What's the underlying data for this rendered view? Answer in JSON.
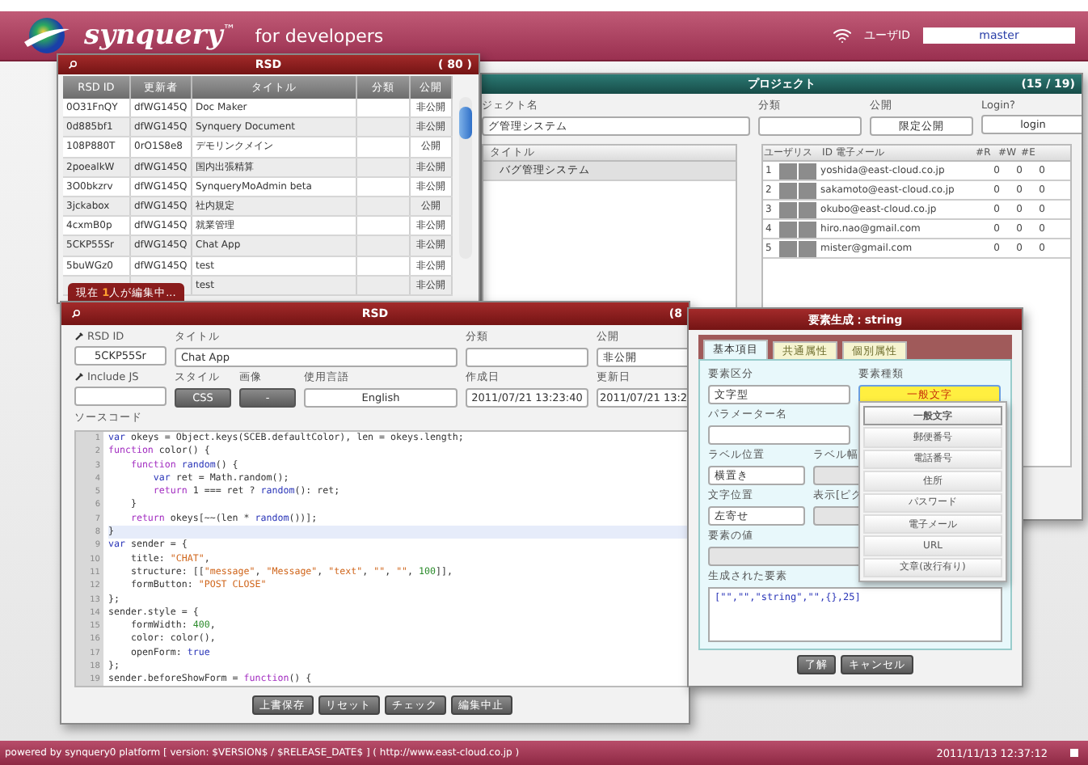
{
  "header": {
    "brand": "synquery",
    "trademark": "™",
    "tagline": "for developers",
    "user_label": "ユーザID",
    "user_value": "master"
  },
  "rsd_list": {
    "title": "RSD",
    "count": "( 80 )",
    "columns": [
      "RSD ID",
      "更新者",
      "タイトル",
      "分類",
      "公開"
    ],
    "rows": [
      {
        "cells": [
          "0O31FnQY",
          "dfWG145Q",
          "Doc Maker",
          "",
          "非公開"
        ]
      },
      {
        "cells": [
          "0d885bf1",
          "dfWG145Q",
          "Synquery Document",
          "",
          "非公開"
        ]
      },
      {
        "cells": [
          "108P880T",
          "0rO1S8e8",
          "デモリンクメイン",
          "",
          "公開"
        ]
      },
      {
        "cells": [
          "2poealkW",
          "dfWG145Q",
          "国内出張精算",
          "",
          "非公開"
        ]
      },
      {
        "cells": [
          "3O0bkzrv",
          "dfWG145Q",
          "SynqueryMoAdmin beta",
          "",
          "非公開"
        ]
      },
      {
        "cells": [
          "3jckabox",
          "dfWG145Q",
          "社内規定",
          "",
          "公開"
        ]
      },
      {
        "cells": [
          "4cxmB0p",
          "dfWG145Q",
          "就業管理",
          "",
          "非公開"
        ]
      },
      {
        "cells": [
          "5CKP55Sr",
          "dfWG145Q",
          "Chat App",
          "",
          "非公開"
        ]
      },
      {
        "cells": [
          "5buWGz0",
          "dfWG145Q",
          "test",
          "",
          "非公開"
        ]
      },
      {
        "cells": [
          "",
          "",
          "test",
          "",
          "非公開"
        ]
      }
    ],
    "notice": "現在 **1**人が編集中..."
  },
  "project": {
    "title": "プロジェクト",
    "count": "(15 / 19)",
    "fields": [
      {
        "label": "ジェクト名",
        "value": "グ管理システム"
      },
      {
        "label": "分類"
      },
      {
        "label": "公開",
        "value": "限定公開"
      },
      {
        "label": "Login?",
        "value": "login"
      }
    ],
    "titles": {
      "header": "タイトル",
      "items": [
        {
          "label": "バグ管理システム",
          "selected": true
        }
      ]
    },
    "users": {
      "columns": [
        "ユーザリス",
        "ID 電子メール",
        "#R",
        "#W",
        "#E"
      ],
      "rows": [
        {
          "no": "1",
          "email": "yoshida@east-cloud.co.jp",
          "r": "0",
          "w": "0",
          "e": "0"
        },
        {
          "no": "2",
          "email": "sakamoto@east-cloud.co.jp",
          "r": "0",
          "w": "0",
          "e": "0"
        },
        {
          "no": "3",
          "email": "okubo@east-cloud.co.jp",
          "r": "0",
          "w": "0",
          "e": "0"
        },
        {
          "no": "4",
          "email": "hiro.nao@gmail.com",
          "r": "0",
          "w": "0",
          "e": "0"
        },
        {
          "no": "5",
          "email": "mister@gmail.com",
          "r": "0",
          "w": "0",
          "e": "0"
        }
      ]
    }
  },
  "rsd_edit": {
    "title": "RSD",
    "count": "(8",
    "field_rows": [
      [
        {
          "label": "RSD ID",
          "kind": "box",
          "value": "5CKP55Sr"
        },
        {
          "label": "タイトル",
          "kind": "input",
          "value": "Chat App"
        },
        {
          "label": "分類",
          "kind": "input"
        },
        {
          "label": "公開",
          "kind": "input",
          "value": "非公開"
        }
      ],
      [
        {
          "label": "Include JS",
          "kind": "input"
        },
        {
          "label": "スタイル",
          "kind": "dark",
          "value": "CSS"
        },
        {
          "label": "画像",
          "kind": "dark",
          "value": "-"
        },
        {
          "label": "使用言語",
          "kind": "box",
          "value": "English"
        },
        {
          "label": "作成日",
          "kind": "box",
          "value": "2011/07/21 13:23:40"
        },
        {
          "label": "更新日",
          "kind": "box",
          "value": "2011/07/21 13:2"
        }
      ]
    ],
    "code_label": "ソースコード",
    "code": [
      {
        "no": "1",
        "highlight": false,
        "tokens": [
          {
            "kind": "keyword",
            "text": "var"
          },
          {
            "kind": "plain",
            "text": " okeys = Object.keys(SCEB.defaultColor), len = okeys.length;"
          }
        ]
      },
      {
        "no": "2",
        "highlight": false,
        "tokens": [
          {
            "kind": "function",
            "text": "function"
          },
          {
            "kind": "plain",
            "text": " color() {"
          }
        ]
      },
      {
        "no": "3",
        "highlight": false,
        "tokens": [
          {
            "kind": "function",
            "text": "    function"
          },
          {
            "kind": "keyword",
            "text": " random"
          },
          {
            "kind": "plain",
            "text": "() {"
          }
        ]
      },
      {
        "no": "4",
        "highlight": false,
        "tokens": [
          {
            "kind": "keyword",
            "text": "        var"
          },
          {
            "kind": "plain",
            "text": " ret = Math.random();"
          }
        ]
      },
      {
        "no": "5",
        "highlight": false,
        "tokens": [
          {
            "kind": "function",
            "text": "        return"
          },
          {
            "kind": "plain",
            "text": " 1 === ret ? "
          },
          {
            "kind": "keyword",
            "text": "random"
          },
          {
            "kind": "plain",
            "text": "(): ret;"
          }
        ]
      },
      {
        "no": "6",
        "highlight": false,
        "tokens": [
          {
            "kind": "plain",
            "text": "    }"
          }
        ]
      },
      {
        "no": "7",
        "highlight": false,
        "tokens": [
          {
            "kind": "function",
            "text": "    return"
          },
          {
            "kind": "plain",
            "text": " okeys[~~(len * "
          },
          {
            "kind": "keyword",
            "text": "random"
          },
          {
            "kind": "plain",
            "text": "())];"
          }
        ]
      },
      {
        "no": "8",
        "highlight": true,
        "tokens": [
          {
            "kind": "plain",
            "text": "}"
          }
        ]
      },
      {
        "no": "9",
        "highlight": false,
        "tokens": [
          {
            "kind": "keyword",
            "text": "var"
          },
          {
            "kind": "plain",
            "text": " sender = {"
          }
        ]
      },
      {
        "no": "10",
        "highlight": false,
        "tokens": [
          {
            "kind": "plain",
            "text": "    title: "
          },
          {
            "kind": "string",
            "text": "\"CHAT\""
          },
          {
            "kind": "plain",
            "text": ","
          }
        ]
      },
      {
        "no": "11",
        "highlight": false,
        "tokens": [
          {
            "kind": "plain",
            "text": "    structure: [["
          },
          {
            "kind": "string",
            "text": "\"message\""
          },
          {
            "kind": "plain",
            "text": ", "
          },
          {
            "kind": "string",
            "text": "\"Message\""
          },
          {
            "kind": "plain",
            "text": ", "
          },
          {
            "kind": "string",
            "text": "\"text\""
          },
          {
            "kind": "plain",
            "text": ", "
          },
          {
            "kind": "string",
            "text": "\"\""
          },
          {
            "kind": "plain",
            "text": ", "
          },
          {
            "kind": "string",
            "text": "\"\""
          },
          {
            "kind": "plain",
            "text": ", "
          },
          {
            "kind": "number",
            "text": "100"
          },
          {
            "kind": "plain",
            "text": "]],"
          }
        ]
      },
      {
        "no": "12",
        "highlight": false,
        "tokens": [
          {
            "kind": "plain",
            "text": "    formButton: "
          },
          {
            "kind": "string",
            "text": "\"POST CLOSE\""
          }
        ]
      },
      {
        "no": "13",
        "highlight": false,
        "tokens": [
          {
            "kind": "plain",
            "text": "};"
          }
        ]
      },
      {
        "no": "14",
        "highlight": false,
        "tokens": [
          {
            "kind": "plain",
            "text": "sender.style = {"
          }
        ]
      },
      {
        "no": "15",
        "highlight": false,
        "tokens": [
          {
            "kind": "plain",
            "text": "    formWidth: "
          },
          {
            "kind": "number",
            "text": "400"
          },
          {
            "kind": "plain",
            "text": ","
          }
        ]
      },
      {
        "no": "16",
        "highlight": false,
        "tokens": [
          {
            "kind": "plain",
            "text": "    color: color(),"
          }
        ]
      },
      {
        "no": "17",
        "highlight": false,
        "tokens": [
          {
            "kind": "plain",
            "text": "    openForm: "
          },
          {
            "kind": "keyword",
            "text": "true"
          }
        ]
      },
      {
        "no": "18",
        "highlight": false,
        "tokens": [
          {
            "kind": "plain",
            "text": "};"
          }
        ]
      },
      {
        "no": "19",
        "highlight": false,
        "tokens": [
          {
            "kind": "plain",
            "text": "sender.beforeShowForm = "
          },
          {
            "kind": "function",
            "text": "function"
          },
          {
            "kind": "plain",
            "text": "() {"
          }
        ]
      }
    ],
    "buttons": [
      "上書保存",
      "リセット",
      "チェック",
      "編集中止"
    ]
  },
  "element_dialog": {
    "title": "要素生成：string",
    "tabs": [
      {
        "label": "基本項目",
        "selected": true
      },
      {
        "label": "共通属性",
        "selected": false
      },
      {
        "label": "個別属性",
        "selected": false
      }
    ],
    "rows": [
      {
        "kind": "pair",
        "fields": [
          {
            "label": "要素区分",
            "value": "文字型",
            "kind": "input"
          },
          {
            "label": "要素種類",
            "value": "一般文字",
            "kind": "focus"
          }
        ]
      },
      {
        "kind": "pair",
        "fields": [
          {
            "label": "パラメーター名",
            "kind": "input"
          }
        ]
      },
      {
        "kind": "short",
        "fields": [
          {
            "label": "ラベル位置",
            "value": "横置き",
            "kind": "input"
          },
          {
            "label": "ラベル幅",
            "kind": "gray"
          }
        ]
      },
      {
        "kind": "short",
        "fields": [
          {
            "label": "文字位置",
            "value": "左寄せ",
            "kind": "input"
          },
          {
            "label": "表示[ピク",
            "kind": "gray"
          }
        ]
      },
      {
        "kind": "full",
        "fields": [
          {
            "label": "要素の値",
            "kind": "gray"
          }
        ]
      }
    ],
    "generated_label": "生成された要素",
    "generated": "[\"\",\"\",\"string\",\"\",{},25]",
    "dropdown": [
      {
        "label": "一般文字",
        "selected": true
      },
      {
        "label": "郵便番号",
        "selected": false
      },
      {
        "label": "電話番号",
        "selected": false
      },
      {
        "label": "住所",
        "selected": false
      },
      {
        "label": "パスワード",
        "selected": false
      },
      {
        "label": "電子メール",
        "selected": false
      },
      {
        "label": "URL",
        "selected": false
      },
      {
        "label": "文章(改行有り)",
        "selected": false
      }
    ],
    "buttons": [
      "了解",
      "キャンセル"
    ]
  },
  "footer": {
    "text": "powered by synquery0 platform [ version: $VERSION$ / $RELEASE_DATE$ ] ( http://www.east-cloud.co.jp )",
    "clock": "2011/11/13 12:37:12"
  }
}
